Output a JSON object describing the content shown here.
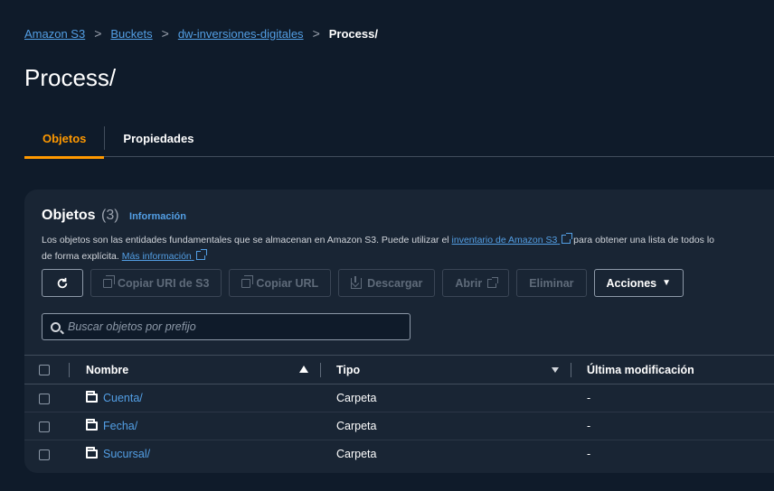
{
  "breadcrumb": {
    "items": [
      "Amazon S3",
      "Buckets",
      "dw-inversiones-digitales"
    ],
    "current": "Process/"
  },
  "page_title": "Process/",
  "tabs": [
    {
      "label": "Objetos",
      "active": true
    },
    {
      "label": "Propiedades",
      "active": false
    }
  ],
  "objects_panel": {
    "title": "Objetos",
    "count": "(3)",
    "info_link": "Información",
    "description_part1": "Los objetos son las entidades fundamentales que se almacenan en Amazon S3. Puede utilizar el ",
    "description_link": "inventario de Amazon S3",
    "description_part2": " para obtener una lista de todos lo",
    "description_line2": "de forma explícita. ",
    "more_info_link": "Más información"
  },
  "toolbar": {
    "refresh_icon": "refresh-icon",
    "copy_s3_uri": "Copiar URI de S3",
    "copy_url": "Copiar URL",
    "download": "Descargar",
    "open": "Abrir",
    "delete": "Eliminar",
    "actions": "Acciones"
  },
  "search": {
    "placeholder": "Buscar objetos por prefijo",
    "value": ""
  },
  "table": {
    "columns": [
      "Nombre",
      "Tipo",
      "Última modificación"
    ],
    "rows": [
      {
        "name": "Cuenta/",
        "type": "Carpeta",
        "modified": "-"
      },
      {
        "name": "Fecha/",
        "type": "Carpeta",
        "modified": "-"
      },
      {
        "name": "Sucursal/",
        "type": "Carpeta",
        "modified": "-"
      }
    ]
  },
  "colors": {
    "background": "#0f1b2a",
    "panel": "#192534",
    "link": "#539fe5",
    "active_tab": "#ff9900"
  }
}
